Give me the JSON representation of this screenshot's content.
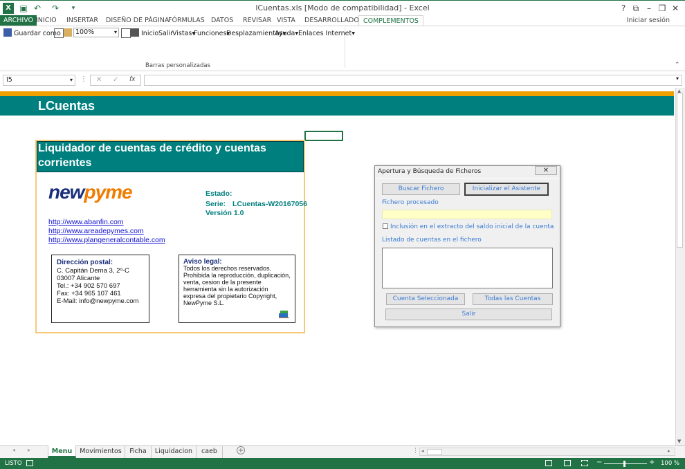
{
  "app": {
    "title": "lCuentas.xls  [Modo de compatibilidad] - Excel",
    "sign_in": "Iniciar sesión",
    "window_buttons": [
      "?",
      "⧉",
      "–",
      "❐",
      "✕"
    ]
  },
  "tabs": [
    {
      "label": "ARCHIVO",
      "kind": "file"
    },
    {
      "label": "INICIO"
    },
    {
      "label": "INSERTAR"
    },
    {
      "label": "DISEÑO DE PÁGINA"
    },
    {
      "label": "FÓRMULAS"
    },
    {
      "label": "DATOS"
    },
    {
      "label": "REVISAR"
    },
    {
      "label": "VISTA"
    },
    {
      "label": "DESARROLLADOR"
    },
    {
      "label": "COMPLEMENTOS",
      "active": true
    }
  ],
  "ribbon": {
    "save_as": "Guardar como",
    "zoom": "100%",
    "inicio": "Inicio",
    "salir": "Salir",
    "vistas": "Vistas",
    "funciones": "Funciones",
    "desplazamientos": "Desplazamientos",
    "ayuda": "Ayuda",
    "enlaces": "Enlaces Internet",
    "group_label": "Barras personalizadas"
  },
  "formula_bar": {
    "name_box": "I5",
    "fx": "fx"
  },
  "sheet": {
    "title": "LCuentas",
    "card_title": "Liquidador de cuentas de crédito y cuentas corrientes",
    "logo_left": "new",
    "logo_right": "pyme",
    "estado": "Estado:",
    "serie_label": "Serie:",
    "serie_value": "LCuentas-W20167056",
    "version": "Versión 1.0",
    "links": [
      "http://www.abanfin.com",
      "http://www.areadepymes.com",
      "http://www.plangeneralcontable.com"
    ],
    "address_title": "Dirección postal:",
    "address_lines": [
      "C. Capitán Dema 3, 2º-C",
      "03007 Alicante",
      "Tel.: +34 902 570 697",
      "Fax:  +34 965 107 461",
      "E-Mail: info@newpyme.com"
    ],
    "legal_title": "Aviso legal:",
    "legal_lines": [
      "Todos los derechos reservados.",
      "Prohibida la reproducción, duplicación,",
      "venta, cesion de la presente",
      "herramienta sin la autorización",
      "expresa del propietario Copyright,",
      "NewPyme S.L."
    ]
  },
  "dialog": {
    "title": "Apertura y Búsqueda de Ficheros",
    "close": "✕",
    "buscar": "Buscar Fichero",
    "inicializar": "Inicializar el Asistente",
    "fichero_label": "Fichero procesado",
    "checkbox_label": "Inclusión en el extracto del saldo inicial de la cuenta",
    "listado_label": "Listado de cuentas en el fichero",
    "cuenta_sel": "Cuenta Seleccionada",
    "todas": "Todas las Cuentas",
    "salir": "Salir"
  },
  "sheet_tabs": [
    {
      "label": "Menu",
      "active": true
    },
    {
      "label": "Movimientos"
    },
    {
      "label": "Ficha"
    },
    {
      "label": "Liquidacion"
    },
    {
      "label": "caeb"
    }
  ],
  "status": {
    "mode": "LISTO",
    "zoom": "100 %"
  },
  "colors": {
    "excel_green": "#217346",
    "teal": "#007f7f",
    "orange": "#f0a000",
    "card_border": "#f8c87a"
  }
}
